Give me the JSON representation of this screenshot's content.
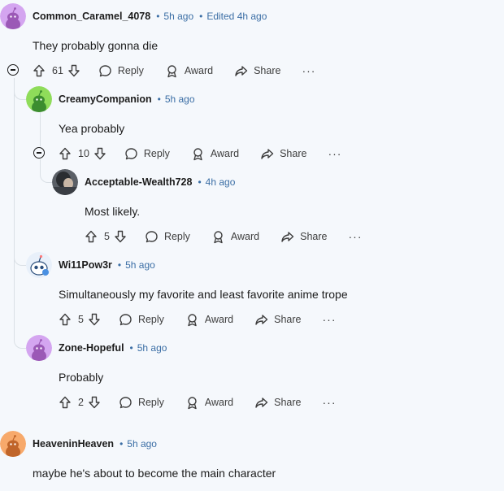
{
  "comments": [
    {
      "username": "Common_Caramel_4078",
      "time": "5h ago",
      "edited": "Edited 4h ago",
      "text": "They probably gonna die",
      "votes": "61",
      "avatar_color": "#d4a5f0"
    },
    {
      "username": "CreamyCompanion",
      "time": "5h ago",
      "text": "Yea probably",
      "votes": "10",
      "avatar_color": "#8fdc5a"
    },
    {
      "username": "Acceptable-Wealth728",
      "time": "4h ago",
      "text": "Most likely.",
      "votes": "5",
      "avatar_color": "#5a5f66"
    },
    {
      "username": "Wi11Pow3r",
      "time": "5h ago",
      "text": "Simultaneously my favorite and least favorite anime trope",
      "votes": "5",
      "avatar_color": "#e8f0fa"
    },
    {
      "username": "Zone-Hopeful",
      "time": "5h ago",
      "text": "Probably",
      "votes": "2",
      "avatar_color": "#d4a5f0"
    },
    {
      "username": "HeaveninHeaven",
      "time": "5h ago",
      "text": "maybe he's about to become the main character",
      "avatar_color": "#f7a96b"
    }
  ],
  "actions": {
    "reply": "Reply",
    "award": "Award",
    "share": "Share",
    "more": "···"
  },
  "colors": {
    "background": "#f5f8fc",
    "accent": "#3b6ea5",
    "thread_line": "#dae0e6"
  }
}
